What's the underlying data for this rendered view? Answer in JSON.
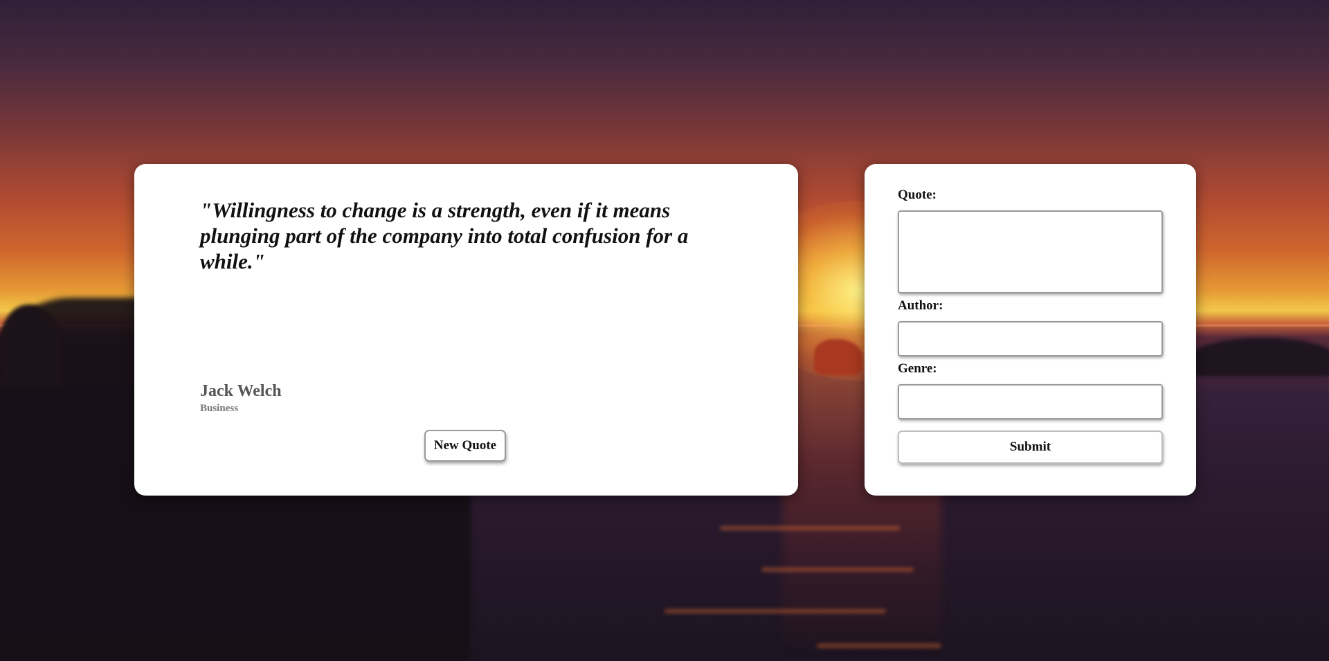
{
  "quote_card": {
    "quote_text": "\"Willingness to change is a strength, even if it means plunging part of the company into total confusion for a while.\"",
    "author": "Jack Welch",
    "genre": "Business",
    "new_quote_label": "New Quote"
  },
  "form": {
    "quote_label": "Quote:",
    "quote_value": "",
    "author_label": "Author:",
    "author_value": "",
    "genre_label": "Genre:",
    "genre_value": "",
    "submit_label": "Submit"
  },
  "colors": {
    "card_background": "#ffffff",
    "quote_text": "#111111",
    "author_text": "#555555",
    "genre_text": "#777777"
  }
}
